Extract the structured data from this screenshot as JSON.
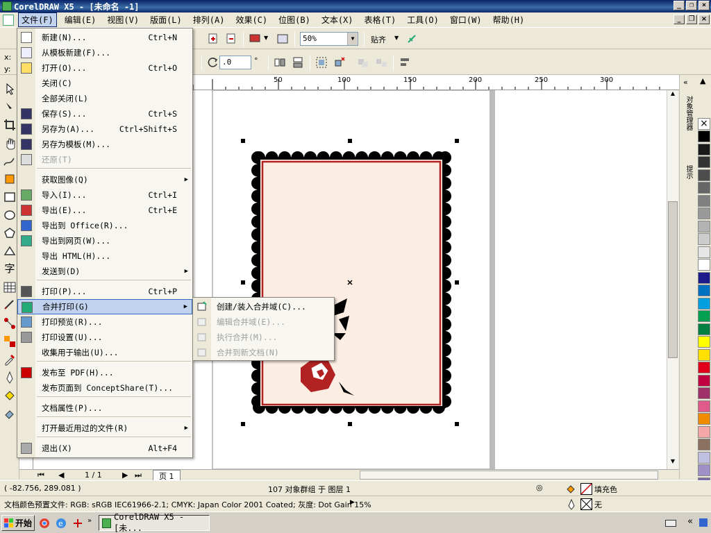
{
  "window": {
    "title": "CorelDRAW X5 - [未命名 -1]"
  },
  "menubar": {
    "items": [
      "文件(F)",
      "编辑(E)",
      "视图(V)",
      "版面(L)",
      "排列(A)",
      "效果(C)",
      "位图(B)",
      "文本(X)",
      "表格(T)",
      "工具(O)",
      "窗口(W)",
      "帮助(H)"
    ]
  },
  "toolbar": {
    "zoom": "50%",
    "snap": "贴齐",
    "angle": ".0",
    "degree": "°",
    "x_label": "x:",
    "y_label": "y:"
  },
  "ruler": {
    "ticks": [
      "50",
      "100",
      "150",
      "200",
      "250",
      "300"
    ]
  },
  "file_menu": {
    "items": [
      {
        "label": "新建(N)...",
        "shortcut": "Ctrl+N"
      },
      {
        "label": "从模板新建(F)...",
        "shortcut": ""
      },
      {
        "label": "打开(O)...",
        "shortcut": "Ctrl+O"
      },
      {
        "label": "关闭(C)",
        "shortcut": ""
      },
      {
        "label": "全部关闭(L)",
        "shortcut": ""
      },
      {
        "label": "保存(S)...",
        "shortcut": "Ctrl+S"
      },
      {
        "label": "另存为(A)...",
        "shortcut": "Ctrl+Shift+S"
      },
      {
        "label": "另存为模板(M)...",
        "shortcut": ""
      },
      {
        "label": "还原(T)",
        "shortcut": ""
      },
      {
        "label": "获取图像(Q)",
        "shortcut": ""
      },
      {
        "label": "导入(I)...",
        "shortcut": "Ctrl+I"
      },
      {
        "label": "导出(E)...",
        "shortcut": "Ctrl+E"
      },
      {
        "label": "导出到 Office(R)...",
        "shortcut": ""
      },
      {
        "label": "导出到网页(W)...",
        "shortcut": ""
      },
      {
        "label": "导出 HTML(H)...",
        "shortcut": ""
      },
      {
        "label": "发送到(D)",
        "shortcut": ""
      },
      {
        "label": "打印(P)...",
        "shortcut": "Ctrl+P"
      },
      {
        "label": "合并打印(G)",
        "shortcut": ""
      },
      {
        "label": "打印预览(R)...",
        "shortcut": ""
      },
      {
        "label": "打印设置(U)...",
        "shortcut": ""
      },
      {
        "label": "收集用于输出(U)...",
        "shortcut": ""
      },
      {
        "label": "发布至 PDF(H)...",
        "shortcut": ""
      },
      {
        "label": "发布页面到 ConceptShare(T)...",
        "shortcut": ""
      },
      {
        "label": "文档属性(P)...",
        "shortcut": ""
      },
      {
        "label": "打开最近用过的文件(R)",
        "shortcut": ""
      },
      {
        "label": "退出(X)",
        "shortcut": "Alt+F4"
      }
    ]
  },
  "merge_submenu": {
    "items": [
      {
        "label": "创建/装入合并域(C)..."
      },
      {
        "label": "编辑合并域(E)..."
      },
      {
        "label": "执行合并(M)..."
      },
      {
        "label": "合并到新文档(N)"
      }
    ]
  },
  "page_nav": {
    "counter": "1 / 1",
    "tab": "页 1"
  },
  "status": {
    "coords": "( -82.756, 289.081 )",
    "selection": "107 对象群组 于 图层 1",
    "fill_label": "填充色",
    "outline_label": "无",
    "color_profile": "文档颜色预置文件: RGB: sRGB IEC61966-2.1; CMYK: Japan Color 2001 Coated; 灰度: Dot Gain 15%"
  },
  "docker": {
    "tab1": "对象管理器",
    "tab2": "提示"
  },
  "taskbar": {
    "start": "开始",
    "task": "CorelDRAW X5 - [未..."
  },
  "palette": {
    "colors": [
      "#000000",
      "#1a1a1a",
      "#333333",
      "#4d4d4d",
      "#666666",
      "#808080",
      "#999999",
      "#b3b3b3",
      "#cccccc",
      "#e6e6e6",
      "#ffffff",
      "#1f1a8c",
      "#0070c0",
      "#00a0e0",
      "#00a050",
      "#008040",
      "#ffff00",
      "#ffe000",
      "#e0001a",
      "#c00040",
      "#a0306a",
      "#e05a8a",
      "#f08c00",
      "#f5a6a6",
      "#8c7060",
      "#c0c0e0",
      "#a090c8",
      "#7a6aa8",
      "#5a6aa0"
    ]
  }
}
